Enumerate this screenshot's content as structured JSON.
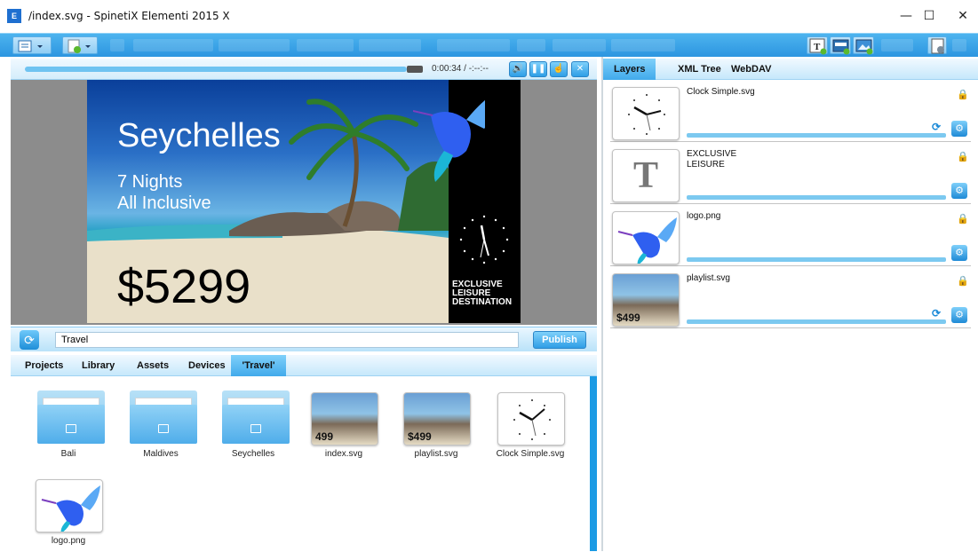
{
  "window": {
    "app_icon_text": "E",
    "title": "/index.svg - SpinetiX Elementi 2015 X",
    "minimize_glyph": "—",
    "maximize_glyph": "☐",
    "close_glyph": "✕"
  },
  "toolbar": {
    "menu_icon": "menu-icon",
    "new_doc_icon": "new-document-icon",
    "insert_text_icon": "insert-text-layer-icon",
    "insert_media_icon": "insert-media-layer-icon",
    "insert_image_icon": "insert-image-layer-icon",
    "properties_icon": "document-properties-icon"
  },
  "player": {
    "time": "0:00:34 / -:--:--",
    "volume_glyph": "🔊",
    "pause_glyph": "❚❚",
    "hand_glyph": "☝",
    "close_glyph": "✕"
  },
  "slide": {
    "title": "Seychelles",
    "line1": "7 Nights",
    "line2": "All Inclusive",
    "price": "$5299",
    "side_lines": [
      "EXCLUSIVE",
      "LEISURE",
      "DESTINATION"
    ]
  },
  "search": {
    "refresh_glyph": "⟳",
    "value": "Travel",
    "publish_label": "Publish"
  },
  "bottom_tabs": [
    {
      "label": "Projects"
    },
    {
      "label": "Library"
    },
    {
      "label": "Assets"
    },
    {
      "label": "Devices"
    },
    {
      "label": "'Travel'"
    }
  ],
  "assets": [
    {
      "label": "Bali",
      "kind": "folder"
    },
    {
      "label": "Maldives",
      "kind": "folder"
    },
    {
      "label": "Seychelles",
      "kind": "folder"
    },
    {
      "label": "index.svg",
      "kind": "thumb",
      "thumb_text": "499"
    },
    {
      "label": "playlist.svg",
      "kind": "thumb",
      "thumb_text": "$499"
    },
    {
      "label": "Clock Simple.svg",
      "kind": "clock"
    },
    {
      "label": "logo.png",
      "kind": "logo"
    }
  ],
  "right_tabs": [
    {
      "label": "Layers"
    },
    {
      "label": "XML Tree"
    },
    {
      "label": "WebDAV"
    }
  ],
  "layers": [
    {
      "name": "Clock Simple.svg",
      "kind": "clock",
      "has_refresh": true
    },
    {
      "name_line1": "EXCLUSIVE",
      "name_line2": "LEISURE",
      "kind": "text",
      "thumb_glyph": "T"
    },
    {
      "name": "logo.png",
      "kind": "logo"
    },
    {
      "name": "playlist.svg",
      "kind": "thumb",
      "thumb_text": "$499",
      "has_refresh": true
    }
  ],
  "icons": {
    "lock": "lock-icon",
    "gear": "⚙",
    "refresh": "⟳"
  }
}
